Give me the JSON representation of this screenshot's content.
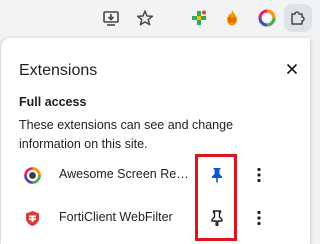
{
  "panel": {
    "title": "Extensions",
    "section_title": "Full access",
    "section_desc": "These extensions can see and change information on this site."
  },
  "extensions": [
    {
      "name": "Awesome Screen Recorder & Screenshot",
      "pinned": true,
      "icon": "awesome-screen-recorder-icon"
    },
    {
      "name": "FortiClient WebFilter",
      "pinned": false,
      "icon": "forticlient-icon"
    }
  ],
  "toolbar_icons": [
    "install-app-icon",
    "bookmark-star-icon",
    "plus-extension-icon",
    "flame-extension-icon",
    "rainbow-circle-extension-icon",
    "puzzle-extensions-icon"
  ],
  "colors": {
    "accent_blue": "#0b57d0",
    "highlight_red": "#e0141e",
    "icon_gray": "#474747"
  }
}
